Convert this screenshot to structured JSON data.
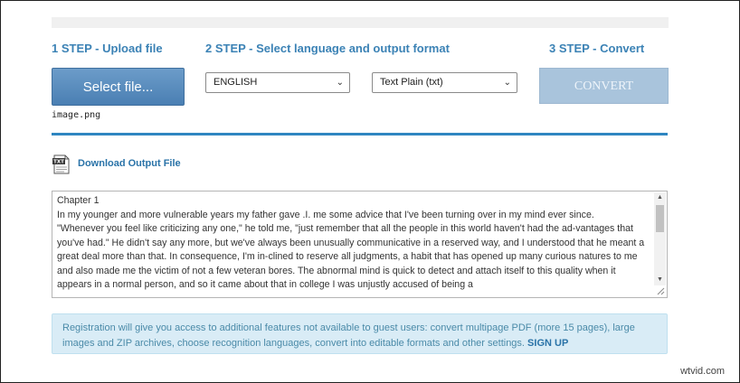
{
  "steps": {
    "step1": "1 STEP - Upload file",
    "step2": "2 STEP - Select language and output format",
    "step3": "3 STEP - Convert"
  },
  "upload": {
    "button_label": "Select file...",
    "file_name": "image.png"
  },
  "language": {
    "selected": "ENGLISH"
  },
  "output_format": {
    "selected": "Text Plain (txt)"
  },
  "convert": {
    "button_label": "CONVERT",
    "enabled": false
  },
  "download": {
    "icon": "txt-file-icon",
    "link_label": "Download Output File"
  },
  "output": {
    "text": "Chapter 1\nIn my younger and more vulnerable years my father gave .I. me some advice that I've been turning over in my mind ever since.\n\"Whenever you feel like criticizing any one,\" he told me, \"just remember that all the people in this world haven't had the ad-vantages that you've had.\" He didn't say any more, but we've always been unusually communicative in a reserved way, and I understood that he meant a great deal more than that. In consequence, I'm in-clined to reserve all judgments, a habit that has opened up many curious natures to me and also made me the victim of not a few veteran bores. The abnormal mind is quick to detect and attach itself to this quality when it appears in a normal person, and so it came about that in college I was unjustly accused of being a"
  },
  "registration": {
    "text": "Registration will give you access to additional features not available to guest users: convert multipage PDF (more 15 pages), large images and ZIP archives, choose recognition languages, convert into editable formats and other settings.",
    "signup_label": "SIGN UP"
  },
  "watermark": "wtvid.com",
  "colors": {
    "step_heading": "#3b82b5",
    "select_button": "#5a8dc0",
    "convert_disabled": "#a9c4dc",
    "divider": "#2e86c1",
    "info_box": "#d9ecf6"
  }
}
